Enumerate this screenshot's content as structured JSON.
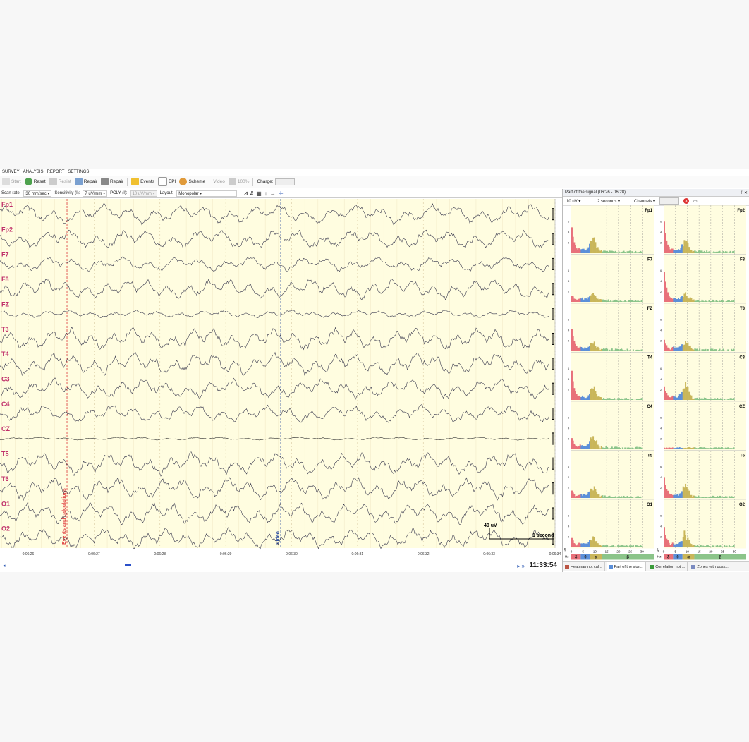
{
  "menu": {
    "tabs": [
      "SURVEY",
      "ANALYSIS",
      "REPORT",
      "SETTINGS"
    ],
    "active": "SURVEY"
  },
  "toolbar": {
    "start": "Start",
    "reset": "Reset",
    "resist": "Resist",
    "repair1": "Repair",
    "repair2": "Repair",
    "events": "Events",
    "epi": "EPI",
    "scheme": "Scheme",
    "video": "Video",
    "zoom": "100%",
    "charge": "Charge:"
  },
  "params": {
    "scan_rate_label": "Scan rate:",
    "scan_rate": "30 mm/sec",
    "sensitivity_label": "Sensitivity (I):",
    "sensitivity": "7 uV/mm",
    "poly_label": "POLY (I):",
    "poly": "10 uV/mm",
    "layout_label": "Layout:",
    "layout": "Monopolar"
  },
  "eeg": {
    "channels": [
      "Fp1",
      "Fp2",
      "F7",
      "F8",
      "FZ",
      "T3",
      "T4",
      "C3",
      "C4",
      "CZ",
      "T5",
      "T6",
      "O1",
      "O2"
    ],
    "time_ticks": [
      "0:06:26",
      "0:06:27",
      "0:06:28",
      "0:06:29",
      "0:06:30",
      "0:06:31",
      "0:06:32",
      "0:06:33",
      "0:06:34"
    ],
    "event_red": "Events and calculations",
    "event_blue": "Video",
    "scale_amp": "40 uV",
    "scale_time": "1 second"
  },
  "status": {
    "clock": "11:33:54"
  },
  "panel": {
    "title": "Part of the signal (06:26 - 06:28)",
    "amp": "10 uV",
    "window": "2 seconds",
    "channels_btn": "Channels",
    "left_channels": [
      "Fp1",
      "F7",
      "FZ",
      "T4",
      "C4",
      "T5",
      "O1"
    ],
    "right_channels": [
      "Fp2",
      "F8",
      "T3",
      "C3",
      "CZ",
      "T6",
      "O2"
    ],
    "freq_ticks": [
      "0",
      "5",
      "10",
      "15",
      "20",
      "25",
      "30"
    ],
    "y_ticks": [
      "2",
      "4",
      "6"
    ],
    "y_unit": "uV",
    "x_unit": "Hz",
    "bands": [
      {
        "label": "δ",
        "color": "#e8717a"
      },
      {
        "label": "θ",
        "color": "#5b8fd9"
      },
      {
        "label": "α",
        "color": "#c9b65a"
      },
      {
        "label": "β",
        "color": "#8bc48a"
      }
    ],
    "tabs": [
      "Heatmap not cal...",
      "Part of the sign...",
      "Correlation not ...",
      "Zones with poss..."
    ]
  }
}
